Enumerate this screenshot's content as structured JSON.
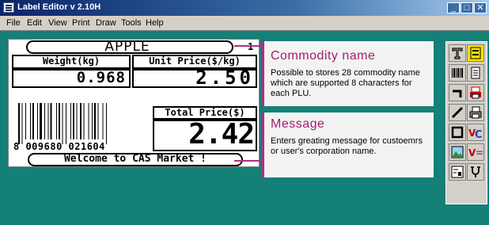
{
  "window": {
    "title": "Label Editor v 2.10H",
    "controls": {
      "minimize": "_",
      "maximize": "□",
      "close": "✕"
    }
  },
  "menu": [
    "File",
    "Edit",
    "View",
    "Print",
    "Draw",
    "Tools",
    "Help"
  ],
  "label": {
    "product_name": "APPLE",
    "plu_number": "1",
    "weight_header": "Weight(kg)",
    "unit_price_header": "Unit Price($/kg)",
    "weight_value": "0.968",
    "unit_price_value": "2.50",
    "total_price_header": "Total Price($)",
    "total_price_value": "2.42",
    "barcode_digits": "8 009680 021604",
    "welcome_message": "Welcome to CAS Market !"
  },
  "callouts": {
    "commodity": {
      "title": "Commodity name",
      "body": "Possible to stores 28 commodity name which are supported 8 characters for each PLU."
    },
    "message": {
      "title": "Message",
      "body": "Enters greating message for custoemrs or user's corporation name."
    }
  },
  "toolbox": {
    "icons": [
      "text-tool-icon",
      "field-tool-icon",
      "barcode-tool-icon",
      "document-tool-icon",
      "line-corner-tool-icon",
      "print-red-tool-icon",
      "diagonal-line-tool-icon",
      "printer-tool-icon",
      "rectangle-tool-icon",
      "variable-text-tool-icon",
      "image-tool-icon",
      "variable-value-tool-icon",
      "layout-tool-icon",
      "settings-tool-icon"
    ]
  },
  "colors": {
    "workspace": "#148078",
    "callout_accent": "#b0307e",
    "title_bar": "#0a246a"
  }
}
